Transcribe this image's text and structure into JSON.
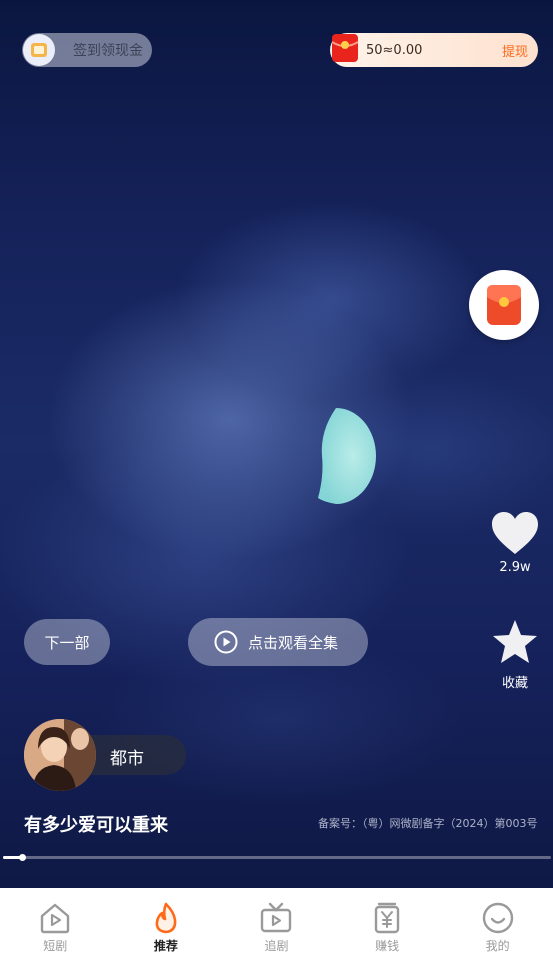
{
  "checkin": {
    "label": "签到领现金"
  },
  "wallet": {
    "amount": "50≈0.00",
    "withdraw_label": "提现"
  },
  "video": {
    "likes": "2.9w",
    "favorite_label": "收藏",
    "next_label": "下一部",
    "watch_all_label": "点击观看全集",
    "genre": "都市",
    "title": "有多少爱可以重来",
    "record_number": "备案号：（粤）网微剧备字（2024）第003号",
    "progress": 0.035
  },
  "nav": {
    "items": [
      {
        "label": "短剧",
        "icon": "play-house-icon",
        "active": false
      },
      {
        "label": "推荐",
        "icon": "flame-icon",
        "active": true
      },
      {
        "label": "追剧",
        "icon": "tv-icon",
        "active": false
      },
      {
        "label": "赚钱",
        "icon": "yuan-icon",
        "active": false
      },
      {
        "label": "我的",
        "icon": "smile-icon",
        "active": false
      }
    ]
  },
  "colors": {
    "accent": "#ff6a1a",
    "nav_active": "#222222",
    "nav_inactive": "#9a9a9a"
  }
}
